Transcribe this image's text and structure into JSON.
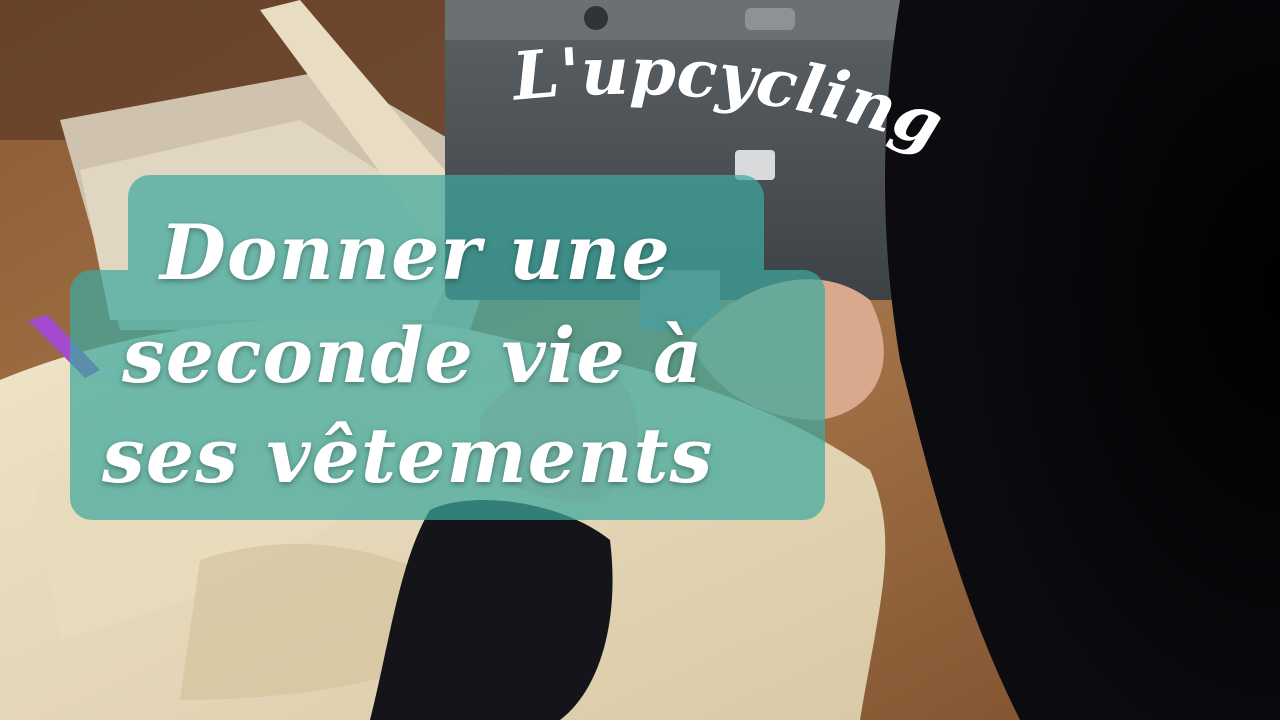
{
  "arc_title": "L'upcycling",
  "headline": {
    "line1": "Donner une",
    "line2": "seconde vie à",
    "line3": "ses vêtements"
  },
  "colors": {
    "banner": "#3fa9a0",
    "text": "#ffffff"
  }
}
